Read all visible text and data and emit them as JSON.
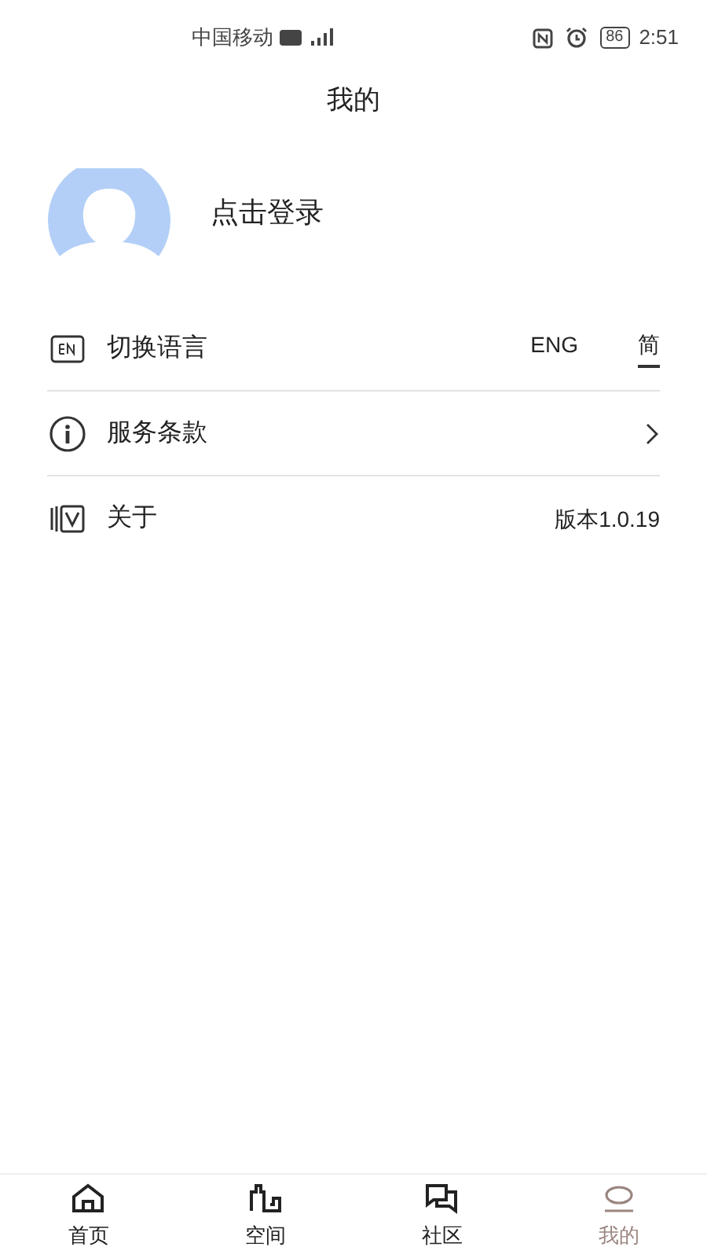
{
  "status_bar": {
    "carrier": "中国移动",
    "battery": "86",
    "time": "2:51"
  },
  "title": "我的",
  "profile": {
    "login": "点击登录"
  },
  "settings": [
    {
      "kind": "language",
      "label": "切换语言",
      "options": [
        {
          "label": "ENG",
          "selected": false
        },
        {
          "label": "简",
          "selected": true
        }
      ]
    },
    {
      "kind": "link",
      "label": "服务条款"
    },
    {
      "kind": "version",
      "label": "关于",
      "value": "版本1.0.19"
    }
  ],
  "tabs": [
    {
      "label": "首页",
      "selected": false
    },
    {
      "label": "空间",
      "selected": false
    },
    {
      "label": "社区",
      "selected": false
    },
    {
      "label": "我的",
      "selected": true
    }
  ]
}
